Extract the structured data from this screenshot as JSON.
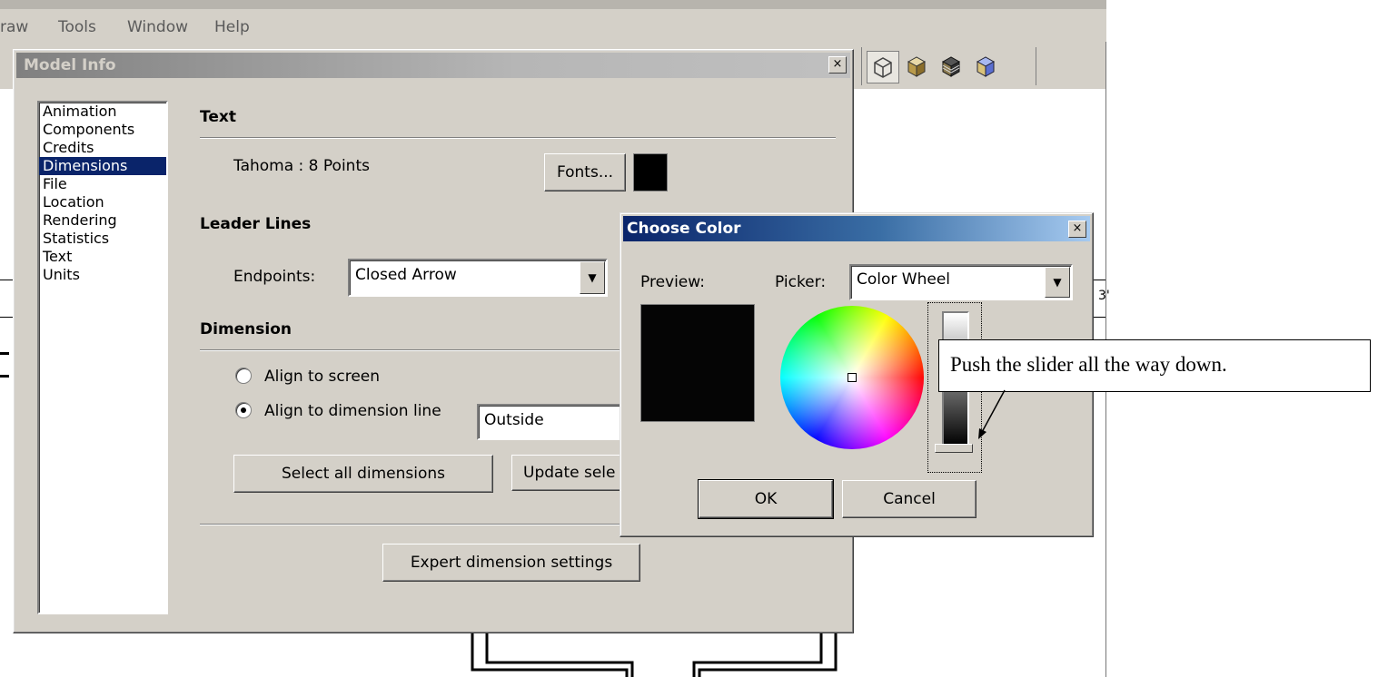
{
  "menubar": {
    "items": [
      "raw",
      "Tools",
      "Window",
      "Help"
    ]
  },
  "toolbar": {
    "icons": [
      "wireframe-cube-icon",
      "shaded-cube-icon",
      "textured-cube-icon",
      "xray-cube-icon"
    ]
  },
  "canvas": {
    "dimension_label": "3'"
  },
  "model_info": {
    "title": "Model Info",
    "close_glyph": "×",
    "categories": [
      "Animation",
      "Components",
      "Credits",
      "Dimensions",
      "File",
      "Location",
      "Rendering",
      "Statistics",
      "Text",
      "Units"
    ],
    "selected_category": "Dimensions",
    "text_section": {
      "heading": "Text",
      "font_value": "Tahoma : 8 Points",
      "fonts_button": "Fonts...",
      "color_swatch": "#000000"
    },
    "leader_lines": {
      "heading": "Leader Lines",
      "endpoints_label": "Endpoints:",
      "endpoints_value": "Closed Arrow"
    },
    "dimension": {
      "heading": "Dimension",
      "align_screen_label": "Align to screen",
      "align_line_label": "Align to dimension line",
      "align_line_value": "Outside",
      "selected_alignment": "Align to dimension line",
      "select_all_button": "Select all dimensions",
      "update_selected_button": "Update sele"
    },
    "expert_button": "Expert dimension settings"
  },
  "choose_color": {
    "title": "Choose Color",
    "close_glyph": "×",
    "preview_label": "Preview:",
    "picker_label": "Picker:",
    "picker_value": "Color Wheel",
    "preview_color": "#050505",
    "ok_button": "OK",
    "cancel_button": "Cancel"
  },
  "annotation": {
    "text": "Push the slider all the way down."
  },
  "colors": {
    "dialog_bg": "#d4d0c8",
    "selection": "#0a246a",
    "active_title_start": "#0a246a",
    "inactive_title_start": "#808080"
  }
}
